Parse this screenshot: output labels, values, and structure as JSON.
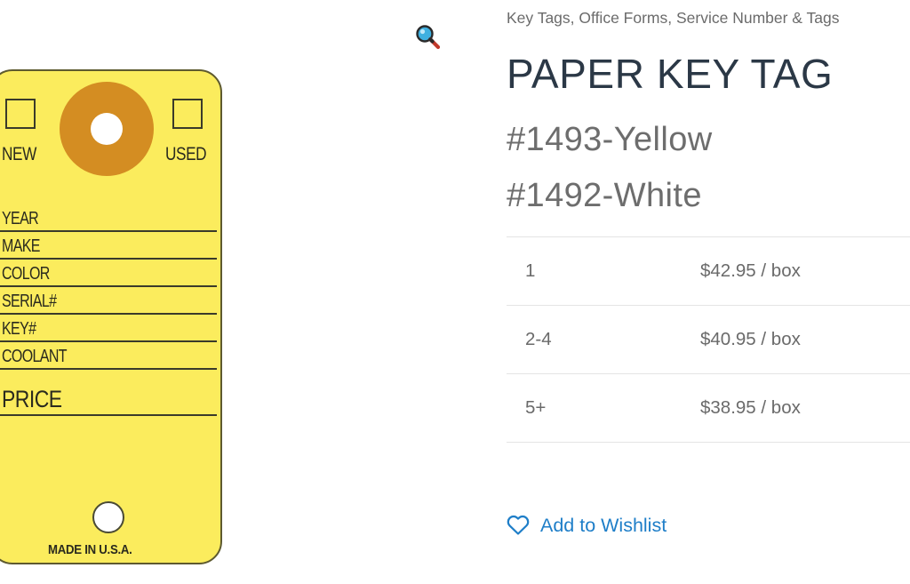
{
  "gallery": {
    "zoom_icon": "magnifier-icon",
    "key_tag": {
      "check_labels": {
        "new": "NEW",
        "used": "USED"
      },
      "fields": [
        "YEAR",
        "MAKE",
        "COLOR",
        "SERIAL#",
        "KEY#",
        "COOLANT"
      ],
      "price_label": "PRICE",
      "made_in": "MADE IN U.S.A.",
      "colors": {
        "tag": "#fbec5d",
        "hole_ring": "#d48d22",
        "border": "#5e5a2f"
      }
    }
  },
  "summary": {
    "categories": [
      "Key Tags",
      "Office Forms",
      "Service Number & Tags"
    ],
    "title": "PAPER KEY TAG",
    "variants": [
      "#1493-Yellow",
      "#1492-White"
    ],
    "pricing": [
      {
        "qty": "1",
        "price": "$42.95 / box"
      },
      {
        "qty": "2-4",
        "price": "$40.95 / box"
      },
      {
        "qty": "5+",
        "price": "$38.95 / box"
      }
    ],
    "wishlist_label": "Add to Wishlist",
    "wishlist_icon": "heart-outline-icon",
    "colors": {
      "link": "#1e7ec8",
      "title": "#2b3846",
      "muted": "#6d6d6d"
    }
  }
}
